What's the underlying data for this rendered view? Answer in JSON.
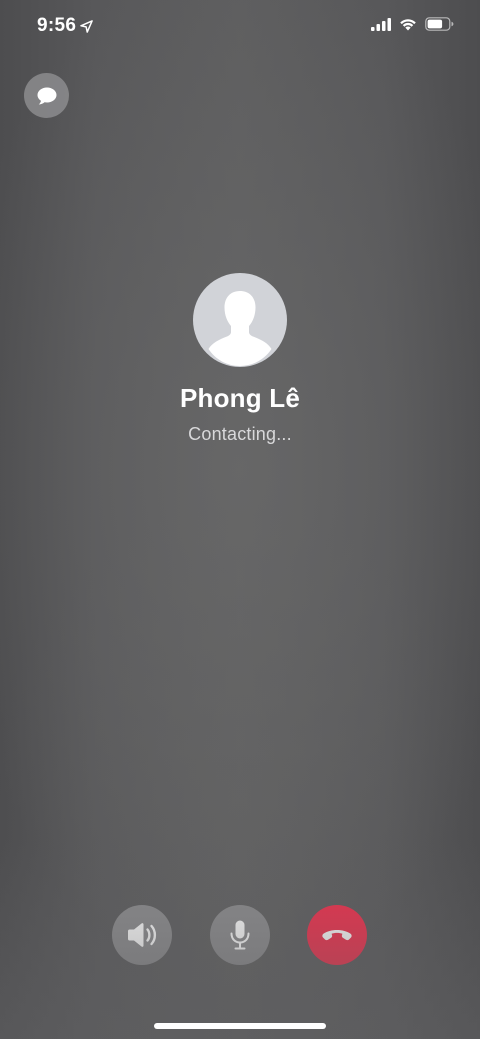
{
  "status_bar": {
    "time": "9:56",
    "icons": [
      "location-arrow-icon",
      "signal-icon",
      "wifi-icon",
      "battery-icon"
    ]
  },
  "message_button": {
    "icon": "message-bubble-icon"
  },
  "contact": {
    "name": "Phong Lê",
    "status": "Contacting..."
  },
  "controls": [
    {
      "name": "speaker",
      "icon": "speaker-icon"
    },
    {
      "name": "mute",
      "icon": "microphone-icon"
    },
    {
      "name": "end-call",
      "icon": "hang-up-icon"
    }
  ],
  "colors": {
    "end_call_red": "#f0304d",
    "control_gray": "#8c8c8e",
    "avatar_gray": "#d1d3d8"
  }
}
